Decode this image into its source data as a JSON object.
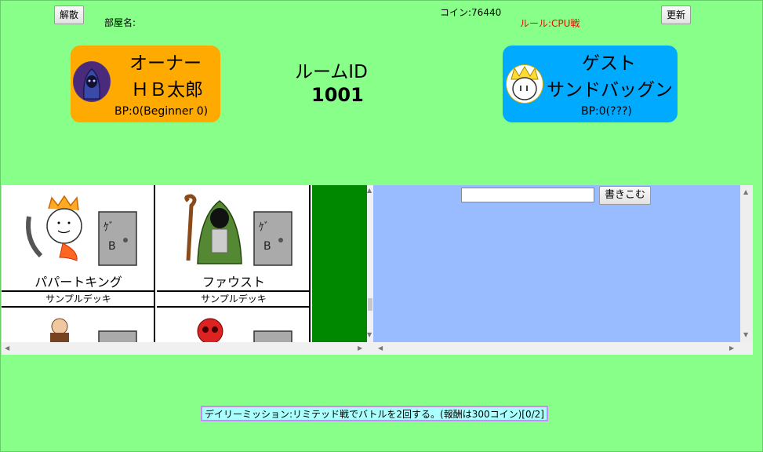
{
  "header": {
    "disband_label": "解散",
    "refresh_label": "更新",
    "room_name_label": "部屋名:",
    "coins_text": "コイン:76440",
    "rule_text": "ルール:CPU戦",
    "rule_color": "#ff0000"
  },
  "owner": {
    "role": "オーナー",
    "name": "ＨＢ太郎",
    "bp": "BP:0(Beginner 0)",
    "card_color": "#ffaa00"
  },
  "room": {
    "label": "ルームID",
    "id": "1001"
  },
  "guest": {
    "role": "ゲスト",
    "name": "サンドバッグン",
    "bp": "BP:0(???)",
    "card_color": "#00aaff"
  },
  "decks": [
    {
      "name": "パパートキング",
      "subtitle": "サンプルデッキ",
      "art": "paper-king-icon"
    },
    {
      "name": "ファウスト",
      "subtitle": "サンプルデッキ",
      "art": "faust-icon"
    },
    {
      "name": "",
      "subtitle": "",
      "art": "old-man-icon"
    },
    {
      "name": "",
      "subtitle": "",
      "art": "red-creature-icon"
    }
  ],
  "chat": {
    "input_value": "",
    "submit_label": "書きこむ",
    "panel_color": "#99bbff"
  },
  "mission": {
    "text": "デイリーミッション:リミテッド戦でバトルを2回する。(報酬は300コイン)[0/2]"
  }
}
